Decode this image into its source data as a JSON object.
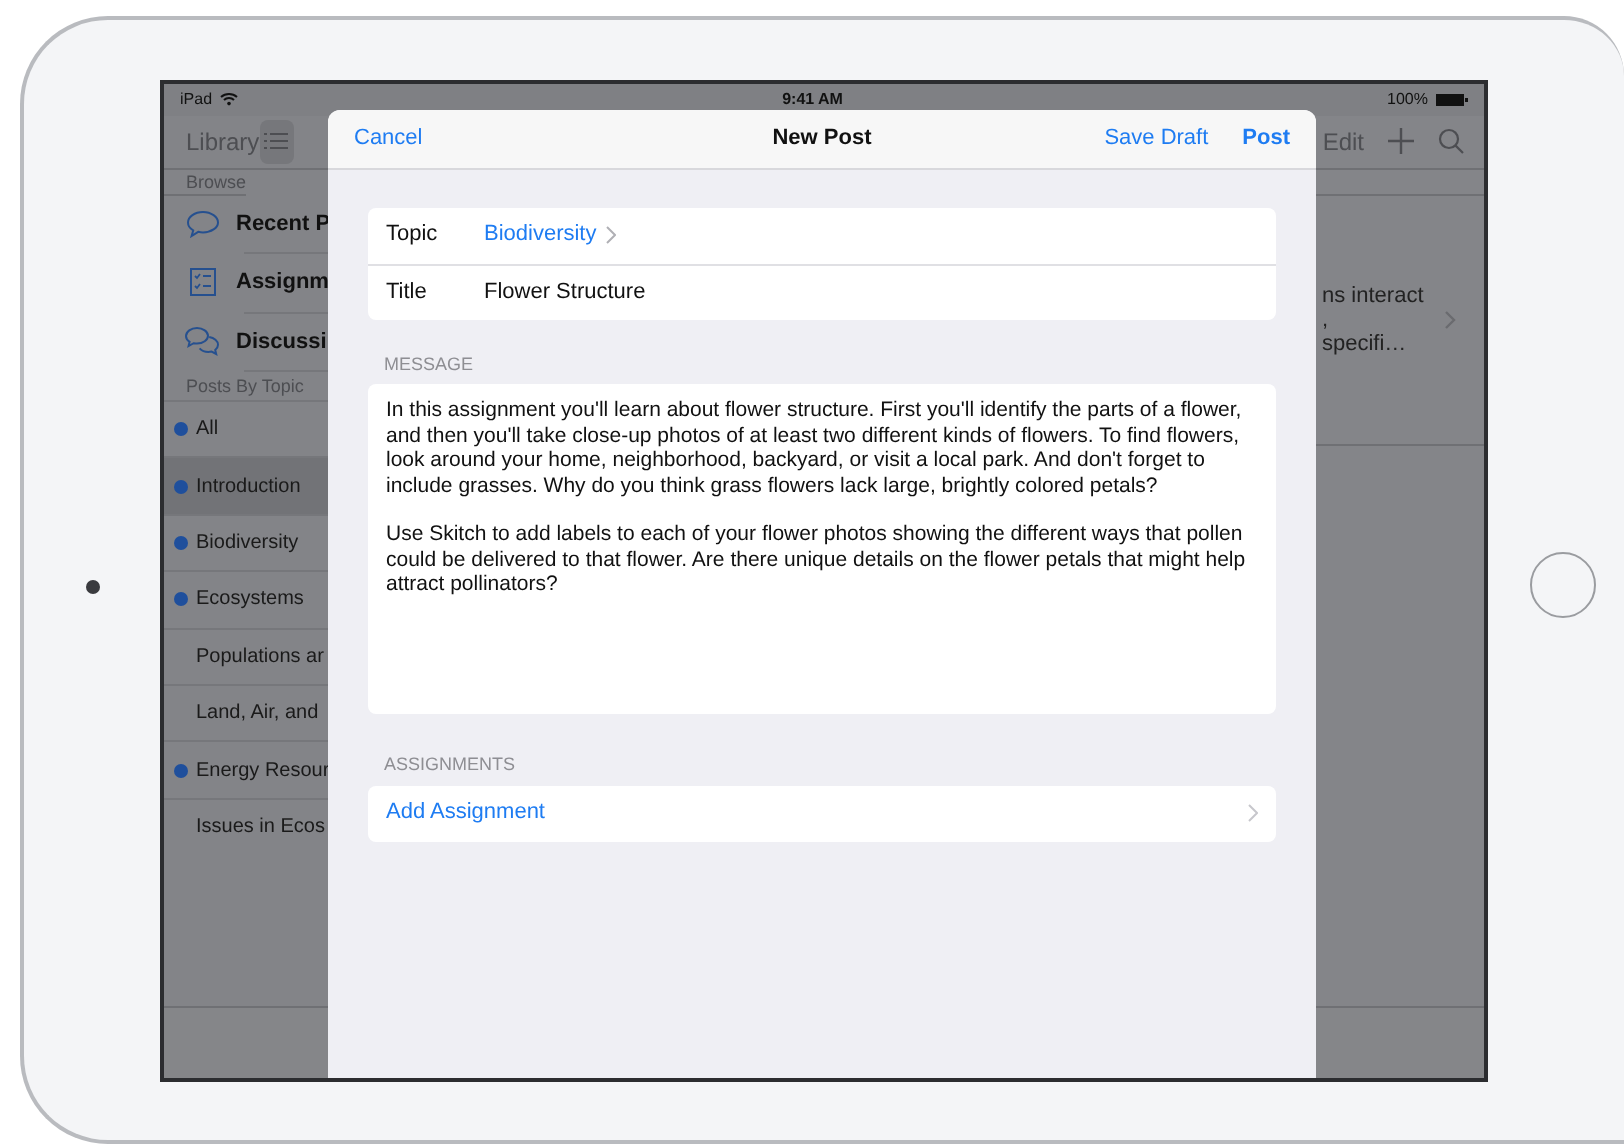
{
  "status_bar": {
    "device": "iPad",
    "time": "9:41 AM",
    "battery": "100%"
  },
  "background": {
    "nav": {
      "title": "Library",
      "edit": "Edit"
    },
    "browse_header": "Browse",
    "browse_items": [
      {
        "label": "Recent P",
        "kind": "bubble"
      },
      {
        "label": "Assignm",
        "kind": "checklist"
      },
      {
        "label": "Discussi",
        "kind": "bubbles"
      }
    ],
    "topics_header": "Posts By Topic",
    "topics": [
      {
        "label": "All",
        "dot": true,
        "selected": false
      },
      {
        "label": "Introduction",
        "dot": true,
        "selected": true
      },
      {
        "label": "Biodiversity",
        "dot": true,
        "selected": false
      },
      {
        "label": "Ecosystems",
        "dot": true,
        "selected": false
      },
      {
        "label": "Populations ar",
        "dot": false,
        "selected": false
      },
      {
        "label": "Land, Air, and",
        "dot": false,
        "selected": false
      },
      {
        "label": "Energy Resour",
        "dot": true,
        "selected": false
      },
      {
        "label": "Issues in Ecos",
        "dot": false,
        "selected": false
      }
    ],
    "post_preview": [
      "ns interact",
      ",",
      "specifi…"
    ]
  },
  "modal": {
    "cancel": "Cancel",
    "title": "New Post",
    "save_draft": "Save Draft",
    "post": "Post",
    "fields": [
      {
        "label": "Topic",
        "value": "Biodiversity",
        "kind": "link"
      },
      {
        "label": "Title",
        "value": "Flower Structure",
        "kind": "text"
      }
    ],
    "message_header": "MESSAGE",
    "message": [
      "In this assignment you'll learn about flower structure. First you'll identify the parts of a flower, and then you'll take close-up photos of at least two different kinds of flowers. To find flowers, look around your home, neighborhood, backyard, or visit a local park. And don't forget to include grasses. Why do you think grass flowers lack large, brightly colored petals?",
      "Use Skitch to add labels to each of your flower photos showing the different ways that pollen could be delivered to that flower. Are there unique details on the flower petals that might help attract pollinators?"
    ],
    "assignments_header": "ASSIGNMENTS",
    "add_assignment": "Add Assignment"
  }
}
